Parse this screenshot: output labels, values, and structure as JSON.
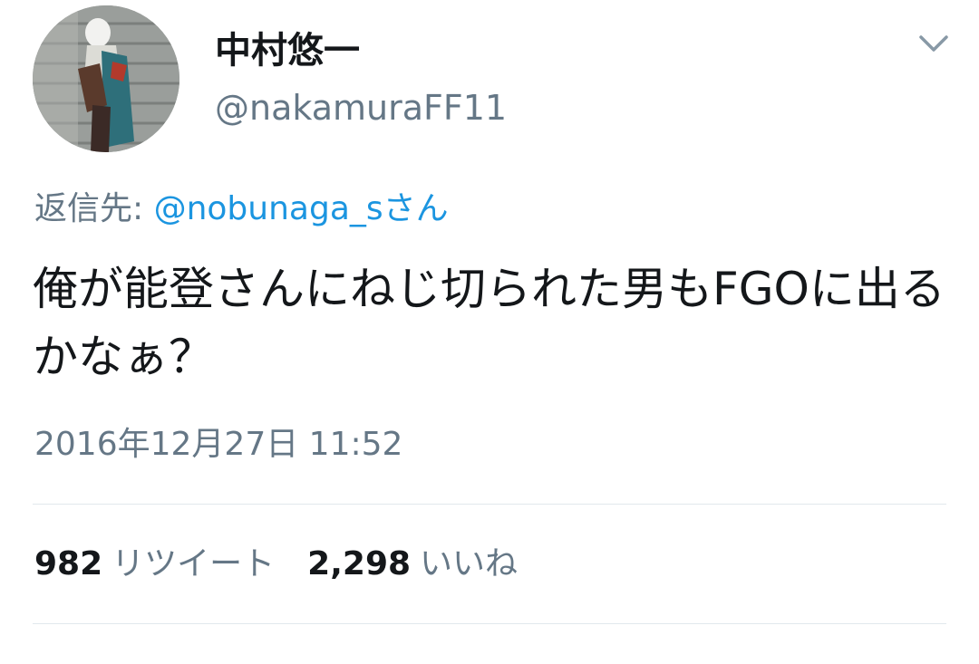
{
  "author": {
    "display_name": "中村悠一",
    "handle": "@nakamuraFF11"
  },
  "reply": {
    "prefix": "返信先: ",
    "target": "@nobunaga_sさん"
  },
  "tweet": {
    "text": "俺が能登さんにねじ切られた男もFGOに出るかなぁ？",
    "timestamp": "2016年12月27日 11:52"
  },
  "stats": {
    "retweets_count": "982",
    "retweets_label": "リツイート",
    "likes_count": "2,298",
    "likes_label": "いいね"
  },
  "icons": {
    "menu": "chevron-down-icon"
  },
  "colors": {
    "text_primary": "#14171a",
    "text_secondary": "#657786",
    "link": "#1b95e0",
    "divider": "#e1e8ed"
  }
}
